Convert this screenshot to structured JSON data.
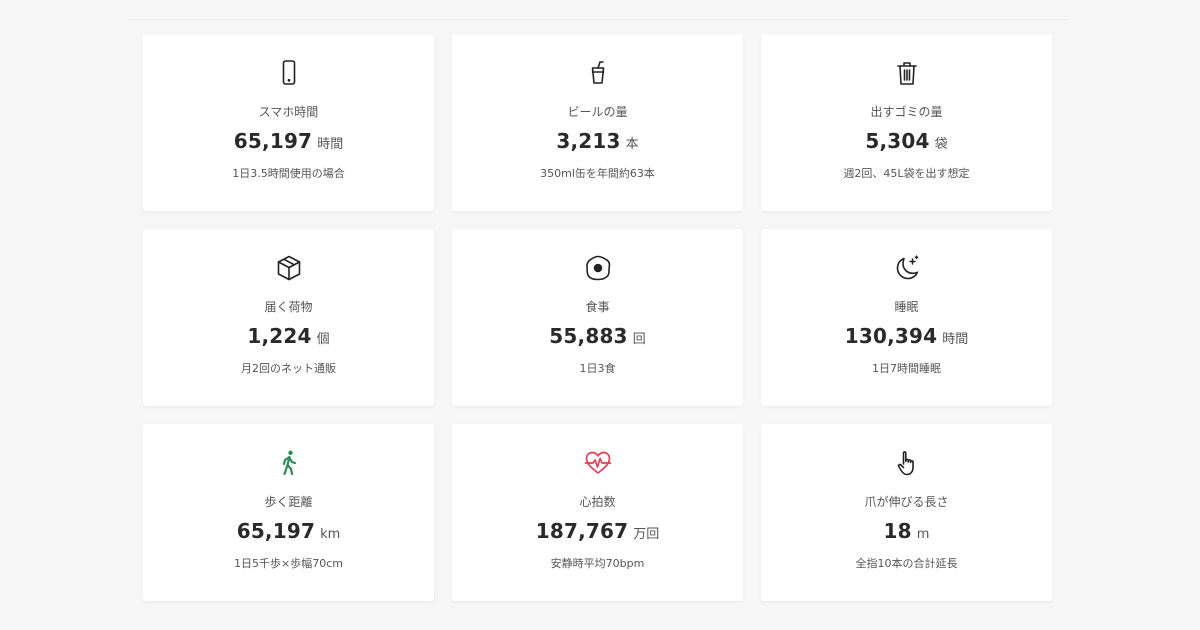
{
  "colors": {
    "icon_default": "#222222",
    "icon_walk": "#2e8b57",
    "icon_heart": "#e0405a"
  },
  "cards": [
    {
      "icon": "smartphone-icon",
      "label": "スマホ時間",
      "value": "65,197",
      "unit": "時間",
      "note": "1日3.5時間使用の場合"
    },
    {
      "icon": "drink-cup-icon",
      "label": "ビールの量",
      "value": "3,213",
      "unit": "本",
      "note": "350ml缶を年間約63本"
    },
    {
      "icon": "trash-icon",
      "label": "出すゴミの量",
      "value": "5,304",
      "unit": "袋",
      "note": "週2回、45L袋を出す想定"
    },
    {
      "icon": "package-box-icon",
      "label": "届く荷物",
      "value": "1,224",
      "unit": "個",
      "note": "月2回のネット通販"
    },
    {
      "icon": "fried-egg-icon",
      "label": "食事",
      "value": "55,883",
      "unit": "回",
      "note": "1日3食"
    },
    {
      "icon": "moon-stars-icon",
      "label": "睡眠",
      "value": "130,394",
      "unit": "時間",
      "note": "1日7時間睡眠"
    },
    {
      "icon": "walking-person-icon",
      "label": "歩く距離",
      "value": "65,197",
      "unit": "km",
      "note": "1日5千歩×歩幅70cm"
    },
    {
      "icon": "heart-pulse-icon",
      "label": "心拍数",
      "value": "187,767",
      "unit": "万回",
      "note": "安静時平均70bpm"
    },
    {
      "icon": "pointing-hand-icon",
      "label": "爪が伸びる長さ",
      "value": "18",
      "unit": "m",
      "note": "全指10本の合計延長"
    }
  ]
}
